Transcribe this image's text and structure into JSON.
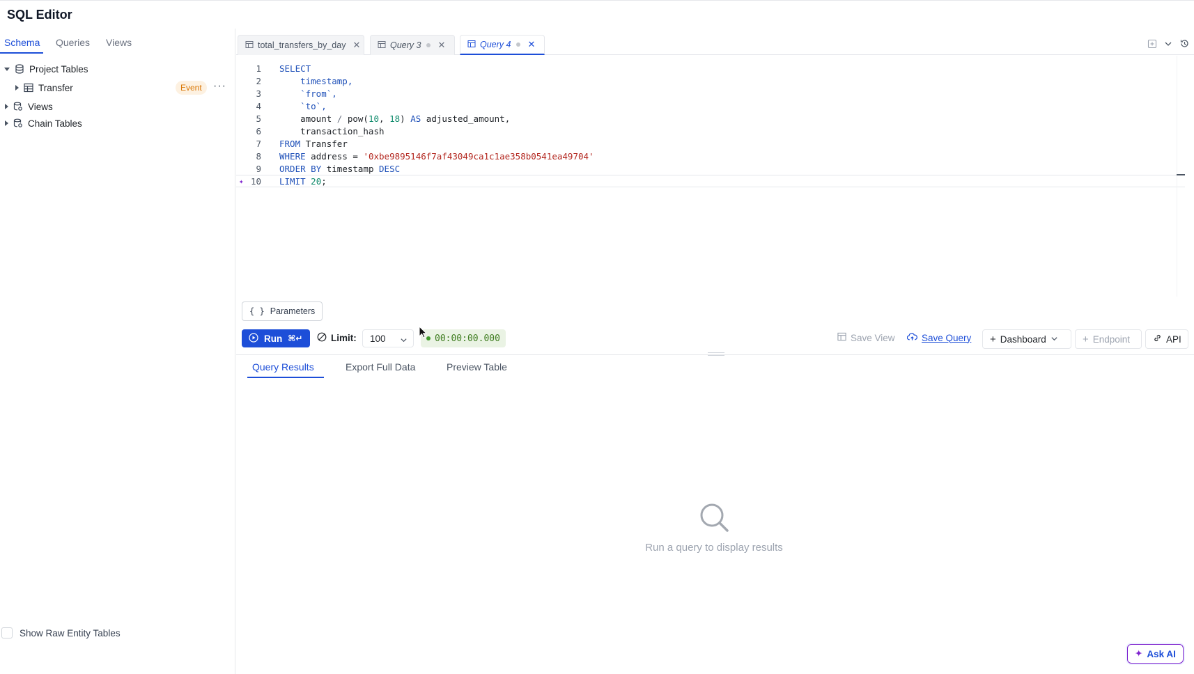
{
  "app": {
    "title": "SQL Editor"
  },
  "sidebar": {
    "tabs": [
      {
        "label": "Schema",
        "active": true
      },
      {
        "label": "Queries",
        "active": false
      },
      {
        "label": "Views",
        "active": false
      }
    ],
    "tree": {
      "project_tables": {
        "label": "Project Tables",
        "expanded": true,
        "icon": "database-icon"
      },
      "transfer": {
        "label": "Transfer",
        "badge": "Event",
        "icon": "table-icon"
      },
      "views": {
        "label": "Views",
        "icon": "database-view-icon"
      },
      "chain_tables": {
        "label": "Chain Tables",
        "icon": "database-view-icon"
      }
    },
    "show_raw_label": "Show Raw Entity Tables"
  },
  "editor_tabs": [
    {
      "label": "total_transfers_by_day",
      "italic": false,
      "active": false
    },
    {
      "label": "Query 3",
      "italic": true,
      "active": false
    },
    {
      "label": "Query 4",
      "italic": true,
      "active": true
    }
  ],
  "code_lines": [
    {
      "n": "1",
      "text": "SELECT"
    },
    {
      "n": "2",
      "text": "    timestamp,"
    },
    {
      "n": "3",
      "text": "    `from`,"
    },
    {
      "n": "4",
      "text": "    `to`,"
    },
    {
      "n": "5",
      "text": "    amount / pow(10, 18) AS adjusted_amount,"
    },
    {
      "n": "6",
      "text": "    transaction_hash"
    },
    {
      "n": "7",
      "text": "FROM Transfer"
    },
    {
      "n": "8",
      "text": "WHERE address = '0xbe9895146f7af43049ca1c1ae358b0541ea49704'"
    },
    {
      "n": "9",
      "text": "ORDER BY timestamp DESC"
    },
    {
      "n": "10",
      "text": "LIMIT 20;"
    }
  ],
  "toolbar": {
    "parameters_label": "Parameters",
    "run_label": "Run",
    "run_shortcut": "⌘↵",
    "limit_label": "Limit:",
    "limit_value": "100",
    "timer": "00:00:00.000",
    "save_view_label": "Save View",
    "save_query_label": "Save Query",
    "dashboard_label": "Dashboard",
    "endpoint_label": "Endpoint",
    "api_label": "API"
  },
  "results": {
    "tabs": [
      {
        "label": "Query Results",
        "active": true
      },
      {
        "label": "Export Full Data",
        "active": false
      },
      {
        "label": "Preview Table",
        "active": false
      }
    ],
    "empty_message": "Run a query to display results"
  },
  "ask_ai_label": "Ask AI",
  "colors": {
    "accent": "#1d4ed8",
    "keyword": "#1d4fb8",
    "string": "#b3261e",
    "number": "#0e8a6b",
    "badge_bg": "#fdf1e1",
    "badge_text": "#d97706",
    "timer_bg": "#eaf3e4",
    "timer_text": "#3f7d20"
  }
}
